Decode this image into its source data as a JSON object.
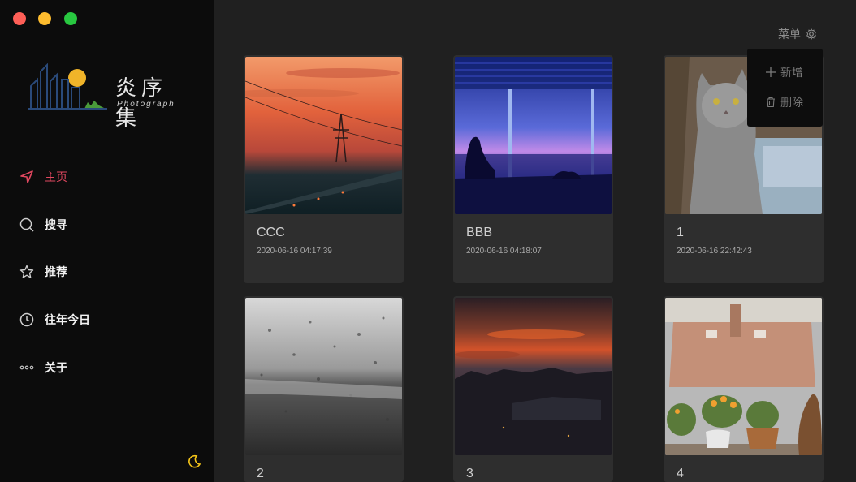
{
  "window": {
    "controls": [
      "close",
      "minimize",
      "maximize"
    ]
  },
  "logo": {
    "title": "炎序集",
    "subtitle": "Photograph"
  },
  "nav": {
    "items": [
      {
        "label": "主页",
        "icon": "navigation-arrow-icon",
        "active": true
      },
      {
        "label": "搜寻",
        "icon": "search-icon",
        "active": false
      },
      {
        "label": "推荐",
        "icon": "star-icon",
        "active": false
      },
      {
        "label": "往年今日",
        "icon": "clock-icon",
        "active": false
      },
      {
        "label": "关于",
        "icon": "more-dots-icon",
        "active": false
      }
    ]
  },
  "theme_toggle": {
    "icon": "moon-icon",
    "color": "#f5c518"
  },
  "menu": {
    "label": "菜单",
    "icon": "gear-icon",
    "dropdown": [
      {
        "label": "新增",
        "icon": "plus-icon"
      },
      {
        "label": "删除",
        "icon": "trash-icon"
      }
    ]
  },
  "gallery": {
    "cards": [
      {
        "title": "CCC",
        "date": "2020-06-16 04:17:39",
        "image": "sunset-power-lines"
      },
      {
        "title": "BBB",
        "date": "2020-06-16 04:18:07",
        "image": "girl-by-window-night-city"
      },
      {
        "title": "1",
        "date": "2020-06-16 22:42:43",
        "image": "gray-cat-on-window"
      },
      {
        "title": "2",
        "date": "",
        "image": "rainy-window-monochrome"
      },
      {
        "title": "3",
        "date": "",
        "image": "red-sky-city-dusk"
      },
      {
        "title": "4",
        "date": "",
        "image": "flowers-on-windowsill"
      }
    ]
  },
  "colors": {
    "accent": "#e0475f",
    "sidebar_bg": "#0c0c0c",
    "main_bg": "#202020",
    "card_bg": "#2e2e2e"
  }
}
